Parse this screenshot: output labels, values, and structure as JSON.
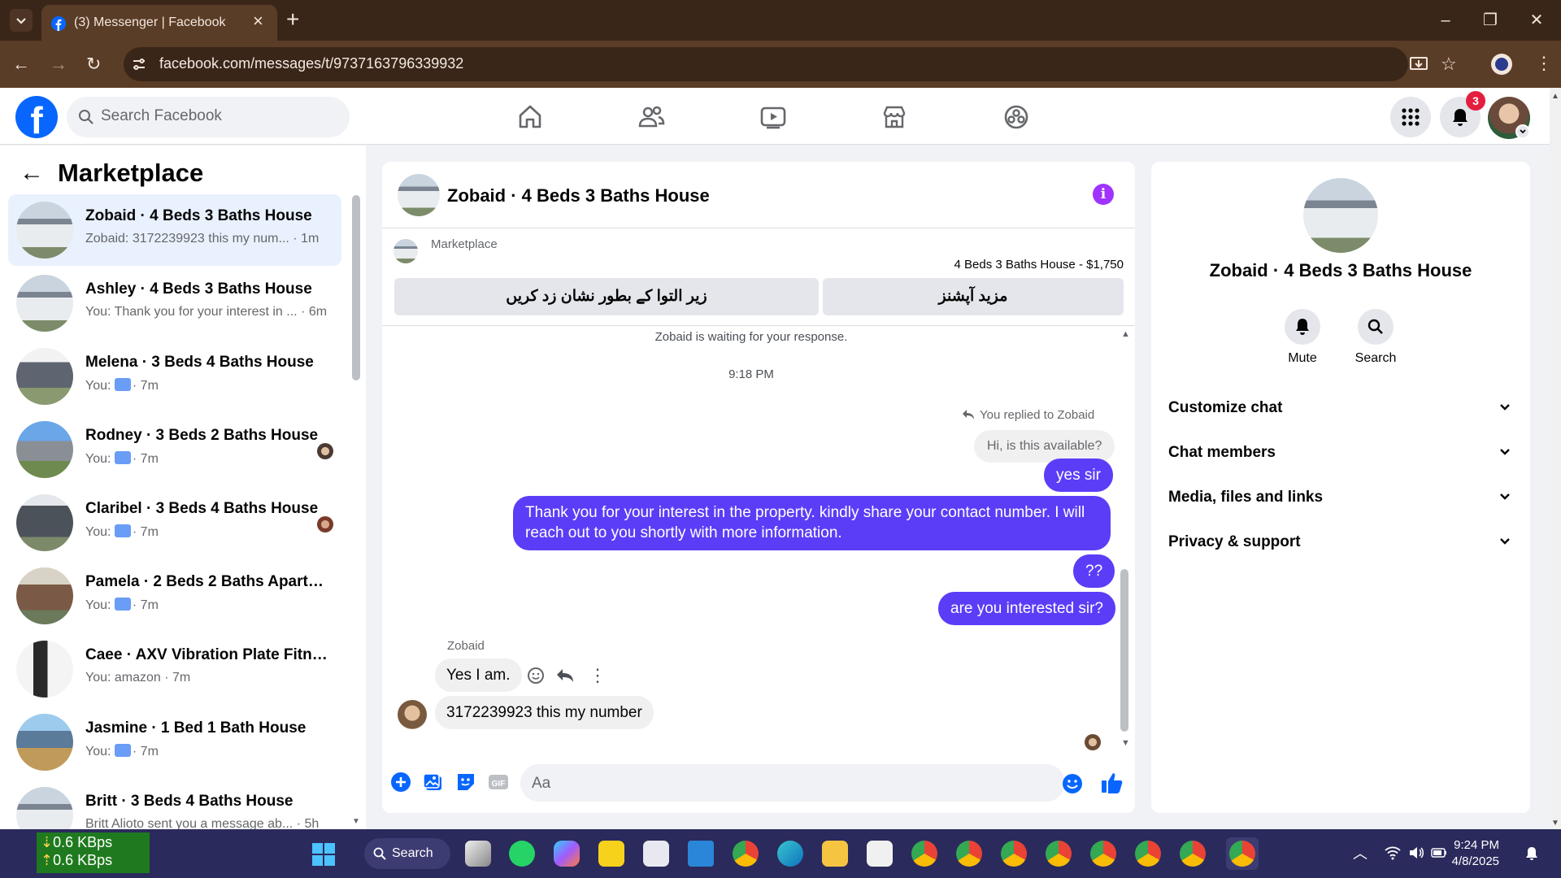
{
  "browser": {
    "tab_title": "(3) Messenger | Facebook",
    "url": "facebook.com/messages/t/9737163796339932"
  },
  "facebook": {
    "search_placeholder": "Search Facebook",
    "notifications_count": "3"
  },
  "left": {
    "title": "Marketplace",
    "conversations": [
      {
        "title": "Zobaid · 4 Beds 3 Baths House",
        "snippet": "Zobaid: 3172239923 this my num... · 1m",
        "active": true
      },
      {
        "title": "Ashley · 4 Beds 3 Baths House",
        "snippet": "You: Thank you for your interest in ... · 6m"
      },
      {
        "title": "Melena · 3 Beds 4 Baths House",
        "snippet_prefix": "You:",
        "snippet": "· 7m"
      },
      {
        "title": "Rodney · 3 Beds 2 Baths House",
        "snippet_prefix": "You:",
        "snippet": "· 7m"
      },
      {
        "title": "Claribel · 3 Beds 4 Baths House",
        "snippet_prefix": "You:",
        "snippet": "· 7m"
      },
      {
        "title": "Pamela · 2 Beds 2 Baths Apartm...",
        "snippet_prefix": "You:",
        "snippet": "· 7m"
      },
      {
        "title": "Caee · AXV Vibration Plate Fitne...",
        "snippet": "You: amazon · 7m"
      },
      {
        "title": "Jasmine · 1 Bed 1 Bath House",
        "snippet_prefix": "You:",
        "snippet": "· 7m"
      },
      {
        "title": "Britt · 3 Beds 4 Baths House",
        "snippet": "Britt Alioto sent you a message ab... · 5h"
      }
    ]
  },
  "chat": {
    "title": "Zobaid · 4 Beds 3 Baths House",
    "marketplace_label": "Marketplace",
    "listing": "4 Beds 3 Baths House - $1,750",
    "btn_mark": "زیر التوا کے بطور نشان زد کریں",
    "btn_more": "مزید آپشنز",
    "waiting": "Zobaid is waiting for your response.",
    "time": "9:18 PM",
    "replied": "You replied to Zobaid",
    "quoted": "Hi, is this available?",
    "out1": "yes sir",
    "out2": "Thank you for your interest in the property.  kindly share your contact number. I will reach out to you shortly with more information.",
    "out3": "??",
    "out4": "are you interested sir?",
    "sender": "Zobaid",
    "in1": "Yes I am.",
    "in2": "3172239923 this my number",
    "composer_placeholder": "Aa"
  },
  "right": {
    "title": "Zobaid · 4 Beds 3 Baths House",
    "mute": "Mute",
    "search": "Search",
    "items": [
      "Customize chat",
      "Chat members",
      "Media, files and links",
      "Privacy & support"
    ]
  },
  "taskbar": {
    "net_down": "0.6 KBps",
    "net_up": "0.6 KBps",
    "search": "Search",
    "time": "9:24 PM",
    "date": "4/8/2025"
  },
  "colors": {
    "accent": "#5b3df7",
    "facebook_blue": "#0866ff",
    "chrome_bg": "#3a2618"
  }
}
